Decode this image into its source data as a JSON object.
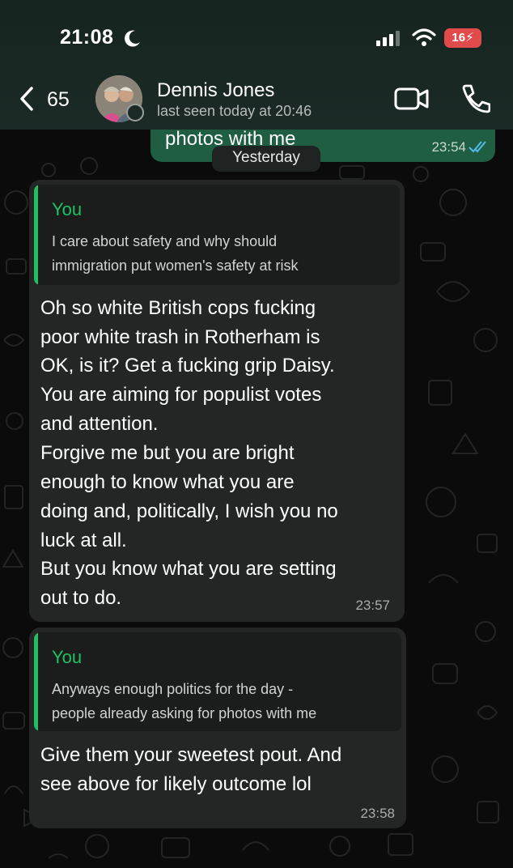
{
  "status_bar": {
    "time": "21:08",
    "battery": "16"
  },
  "header": {
    "back_count": "65",
    "contact_name": "Dennis Jones",
    "last_seen": "last seen today at 20:46"
  },
  "previous_message": {
    "text": "photos with me",
    "time": "23:54"
  },
  "date_separator": "Yesterday",
  "messages": [
    {
      "quote": {
        "author": "You",
        "lines": [
          "I care about safety and why should",
          "immigration put women's safety at risk"
        ]
      },
      "lines": [
        "Oh so white British cops fucking",
        "poor white trash in Rotherham is",
        "OK, is it? Get a fucking grip Daisy.",
        "You are aiming for populist votes",
        "and attention.",
        "Forgive me but you are bright",
        "enough to know what you are",
        "doing and, politically, I wish you no",
        "luck at all.",
        "But you know what you are setting",
        "out to do."
      ],
      "time": "23:57"
    },
    {
      "quote": {
        "author": "You",
        "lines": [
          "Anyways enough politics for the day -",
          "people already asking for photos with me"
        ]
      },
      "lines": [
        "Give them your sweetest pout. And",
        "see above for likely outcome lol"
      ],
      "time": "23:58"
    }
  ],
  "colors": {
    "accent_green": "#21c063",
    "bubble_incoming": "#242626",
    "bubble_outgoing": "#1f5e43",
    "read_ticks": "#53bdeb",
    "battery_low": "#e24b4b"
  },
  "icons": [
    "moon-icon",
    "signal-icon",
    "wifi-icon",
    "battery-icon",
    "back-chevron-icon",
    "video-call-icon",
    "phone-icon",
    "read-ticks-icon"
  ]
}
